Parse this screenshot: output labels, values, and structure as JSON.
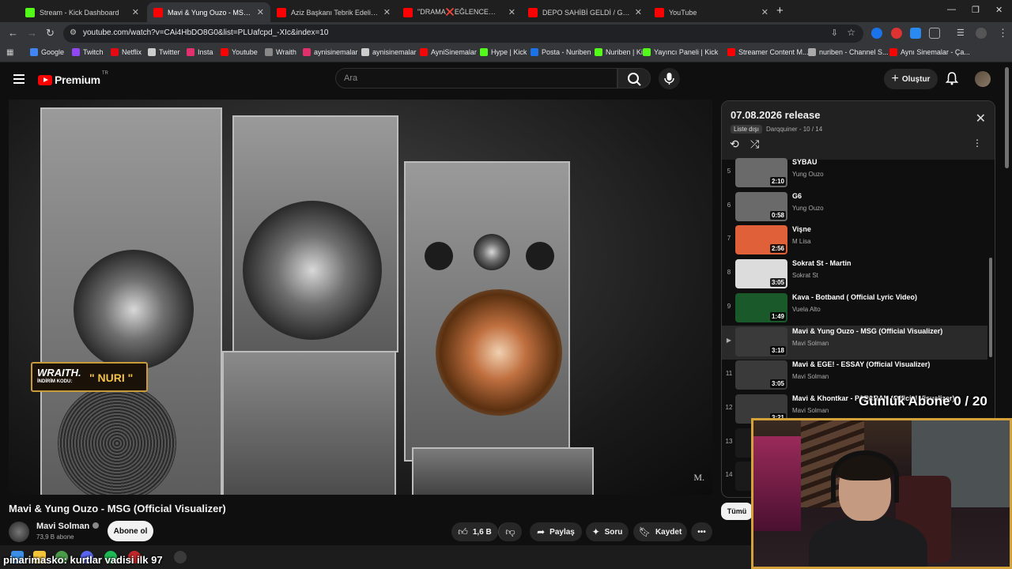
{
  "browser": {
    "tabs": [
      {
        "label": "Stream - Kick Dashboard",
        "fav": "#53fc18",
        "icon": "kick-icon"
      },
      {
        "label": "Mavi & Yung Ouzo - MSG (",
        "fav": "#ff0000",
        "icon": "youtube-icon",
        "active": true
      },
      {
        "label": "Aziz Başkanı Tebrik Edelim | Yo",
        "fav": "#ff0000",
        "icon": "youtube-icon"
      },
      {
        "label": "\"DRAMA❌EĞLENCE❎\" Kick",
        "fav": "#ff0000",
        "icon": "youtube-icon"
      },
      {
        "label": "DEPO SAHİBİ GELDİ / GERGİNL",
        "fav": "#ff0000",
        "icon": "youtube-icon"
      },
      {
        "label": "YouTube",
        "fav": "#ff0000",
        "icon": "youtube-icon"
      }
    ],
    "new_tab": "+",
    "url": "youtube.com/watch?v=CAi4HbDO8G0&list=PLUafcpd_-XIc&index=10",
    "bookmarks": [
      {
        "label": "Google",
        "fav": "#4285f4"
      },
      {
        "label": "Twitch",
        "fav": "#9146ff"
      },
      {
        "label": "Netflix",
        "fav": "#e50914"
      },
      {
        "label": "Twitter",
        "fav": "#cccccc"
      },
      {
        "label": "Insta",
        "fav": "#e1306c"
      },
      {
        "label": "Youtube",
        "fav": "#ff0000"
      },
      {
        "label": "Wraith",
        "fav": "#888888"
      },
      {
        "label": "aynisinemalar",
        "fav": "#e1306c"
      },
      {
        "label": "aynisinemalar",
        "fav": "#cccccc"
      },
      {
        "label": "AyniSinemalar",
        "fav": "#ff0000"
      },
      {
        "label": "Hype | Kick",
        "fav": "#53fc18"
      },
      {
        "label": "Posta - Nuriben",
        "fav": "#1a73e8"
      },
      {
        "label": "Nuriben | Kick",
        "fav": "#53fc18"
      },
      {
        "label": "Yayıncı Paneli | Kick",
        "fav": "#53fc18"
      },
      {
        "label": "Streamer Content M...",
        "fav": "#ff0000"
      },
      {
        "label": "nuriben - Channel S...",
        "fav": "#aaaaaa"
      },
      {
        "label": "Aynı Sinemalar - Ça...",
        "fav": "#ff0000"
      }
    ]
  },
  "youtube": {
    "brand": "Premium",
    "region": "TR",
    "search_placeholder": "Ara",
    "create_label": "Oluştur",
    "video": {
      "title": "Mavi & Yung Ouzo - MSG (Official Visualizer)",
      "watermark": "M.",
      "promo_brand": "WRAITH.",
      "promo_code_label": "İNDİRİM KODU:",
      "promo_code": "\" NURI \""
    },
    "channel": {
      "name": "Mavi Solman",
      "subs": "73,9 B abone",
      "subscribe_label": "Abone ol"
    },
    "actions": {
      "likes": "1,6 B",
      "share": "Paylaş",
      "ask": "Soru",
      "save": "Kaydet",
      "more": "•••"
    },
    "all_chip": "Tümü"
  },
  "playlist": {
    "title": "07.08.2026 release",
    "privacy": "Liste dışı",
    "owner_progress": "Darqquiner - 10 / 14",
    "items": [
      {
        "index": "5",
        "title": "SYBAU",
        "artist": "Yung Ouzo",
        "duration": "2:10",
        "thumb": "#6a6a6a"
      },
      {
        "index": "6",
        "title": "G6",
        "artist": "Yung Ouzo",
        "duration": "0:58",
        "thumb": "#6a6a6a"
      },
      {
        "index": "7",
        "title": "Vişne",
        "artist": "M Lisa",
        "duration": "2:56",
        "thumb": "#e0603a"
      },
      {
        "index": "8",
        "title": "Sokrat St - Martin",
        "artist": "Sokrat St",
        "duration": "3:05",
        "thumb": "#dcdcdc"
      },
      {
        "index": "9",
        "title": "Kava - Botband ( Official Lyric Video)",
        "artist": "Vuela Alto",
        "duration": "1:49",
        "thumb": "#1a5a2a"
      },
      {
        "index": "▶",
        "title": "Mavi & Yung Ouzo - MSG (Official Visualizer)",
        "artist": "Mavi Solman",
        "duration": "3:18",
        "thumb": "#3a3a3a",
        "active": true
      },
      {
        "index": "11",
        "title": "Mavi & EGE! - ESSAY (Official Visualizer)",
        "artist": "Mavi Solman",
        "duration": "3:05",
        "thumb": "#3a3a3a"
      },
      {
        "index": "12",
        "title": "Mavi & Khontkar - PAPARAN (Official Visualizer)",
        "artist": "Mavi Solman",
        "duration": "3:21",
        "thumb": "#3a3a3a"
      },
      {
        "index": "13",
        "title": "",
        "artist": "",
        "duration": "",
        "thumb": "#1a1a1a"
      },
      {
        "index": "14",
        "title": "",
        "artist": "",
        "duration": "",
        "thumb": "#1a1a1a"
      }
    ]
  },
  "overlay": {
    "sub_goal": "Günlük Abone 0 / 20",
    "chat_line": "pinarimasko: kurtlar vadisi ilk 97"
  },
  "colors": {
    "accent_gold": "#d4a23a",
    "yt_red": "#ff0000"
  }
}
